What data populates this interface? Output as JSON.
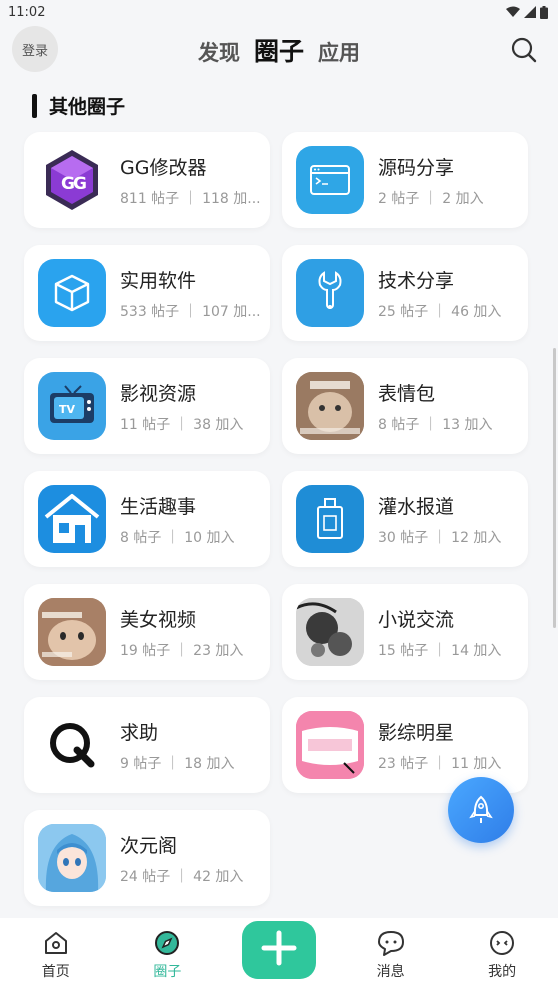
{
  "status": {
    "time": "11:02"
  },
  "header": {
    "login": "登录",
    "tabs": [
      "发现",
      "圈子",
      "应用"
    ],
    "active_tab": "圈子"
  },
  "section": {
    "title": "其他圈子"
  },
  "circles": [
    {
      "name": "GG修改器",
      "meta": "811 帖子 ｜ 118 加...",
      "icon": "gg-logo-icon"
    },
    {
      "name": "源码分享",
      "meta": "2 帖子 ｜ 2 加入",
      "icon": "code-window-icon"
    },
    {
      "name": "实用软件",
      "meta": "533 帖子 ｜ 107 加...",
      "icon": "cube-icon"
    },
    {
      "name": "技术分享",
      "meta": "25 帖子 ｜ 46 加入",
      "icon": "wrench-icon"
    },
    {
      "name": "影视资源",
      "meta": "11 帖子 ｜ 38 加入",
      "icon": "tv-icon"
    },
    {
      "name": "表情包",
      "meta": "8 帖子 ｜ 13 加入",
      "icon": "cat-meme-icon"
    },
    {
      "name": "生活趣事",
      "meta": "8 帖子 ｜ 10 加入",
      "icon": "house-icon"
    },
    {
      "name": "灌水报道",
      "meta": "30 帖子 ｜ 12 加入",
      "icon": "bottle-icon"
    },
    {
      "name": "美女视频",
      "meta": "19 帖子 ｜ 23 加入",
      "icon": "cat-photo-icon"
    },
    {
      "name": "小说交流",
      "meta": "15 帖子 ｜ 14 加入",
      "icon": "ink-flower-icon"
    },
    {
      "name": "求助",
      "meta": "9 帖子 ｜ 18 加入",
      "icon": "q-logo-icon"
    },
    {
      "name": "影综明星",
      "meta": "23 帖子 ｜ 11 加入",
      "icon": "pink-card-icon"
    },
    {
      "name": "次元阁",
      "meta": "24 帖子 ｜ 42 加入",
      "icon": "anime-girl-icon"
    }
  ],
  "nav": {
    "home": "首页",
    "circles": "圈子",
    "messages": "消息",
    "mine": "我的"
  },
  "colors": {
    "accent": "#33b89a",
    "publish": "#2fc79c",
    "fab": "#3a90f0"
  }
}
